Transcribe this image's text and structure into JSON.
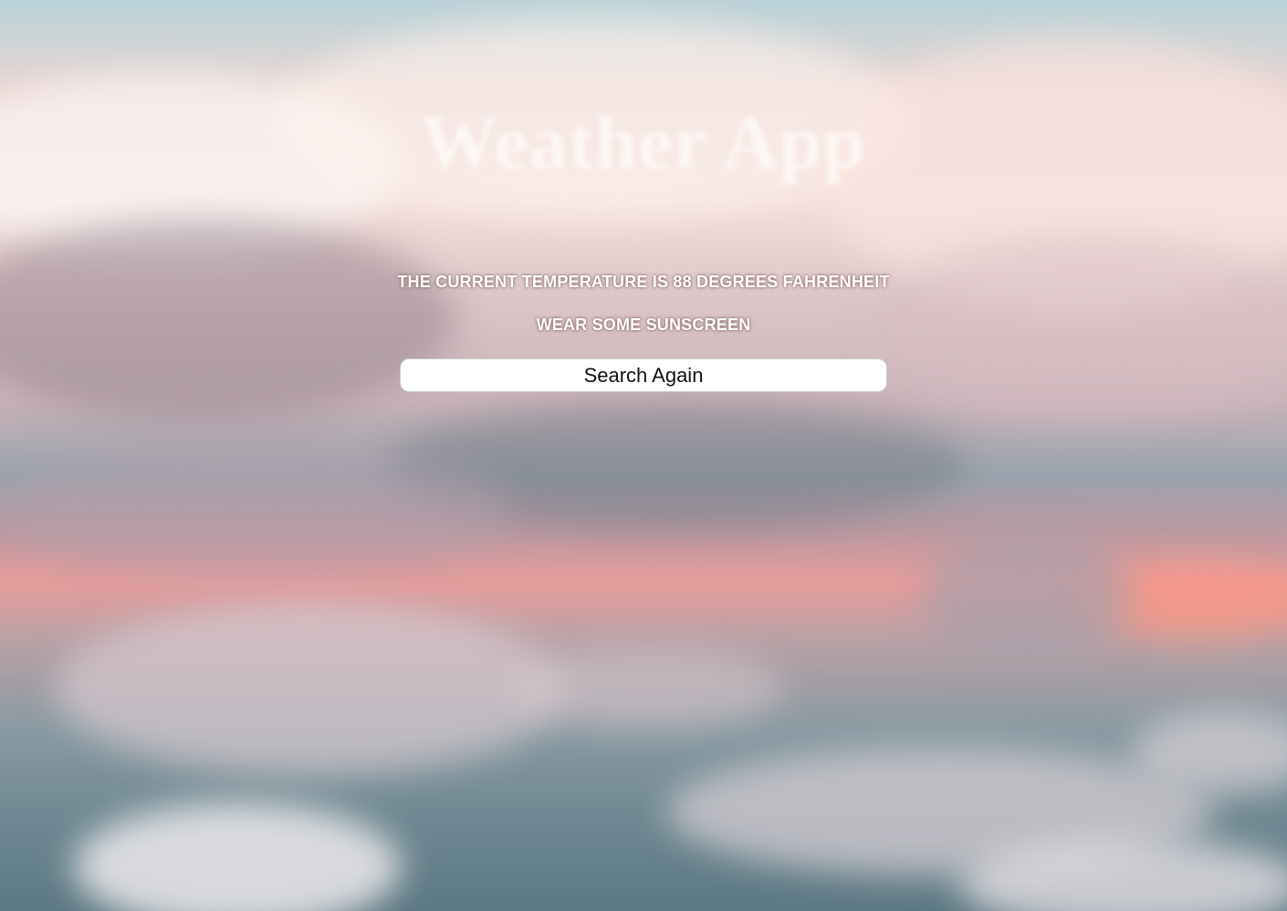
{
  "header": {
    "title": "Weather App"
  },
  "result": {
    "temperature_message": "THE CURRENT TEMPERATURE IS 88 DEGREES FAHRENHEIT",
    "advice_message": "WEAR SOME SUNSCREEN"
  },
  "actions": {
    "search_again_label": "Search Again"
  },
  "theme": {
    "text_color": "#ffffff",
    "button_bg": "#ffffff"
  }
}
